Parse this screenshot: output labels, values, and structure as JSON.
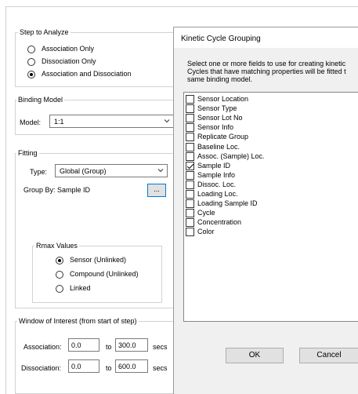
{
  "step": {
    "title": "Step to Analyze",
    "options": [
      "Association Only",
      "Dissociation Only",
      "Association and Dissociation"
    ],
    "selected": 2
  },
  "binding": {
    "title": "Binding Model",
    "model_label": "Model:",
    "model_value": "1:1"
  },
  "fitting": {
    "title": "Fitting",
    "type_label": "Type:",
    "type_value": "Global (Group)",
    "group_by": "Group By:  Sample ID",
    "browse_label": "...",
    "rmax": {
      "title": "Rmax Values",
      "options": [
        "Sensor (Unlinked)",
        "Compound (Unlinked)",
        "Linked"
      ],
      "selected": 0
    }
  },
  "window": {
    "title": "Window of Interest (from start of step)",
    "association_label": "Association:",
    "association_from": "0.0",
    "association_to": "300.0",
    "dissociation_label": "Dissociation:",
    "dissociation_from": "0.0",
    "dissociation_to": "600.0",
    "to_label": "to",
    "unit": "secs"
  },
  "dialog": {
    "title": "Kinetic Cycle Grouping",
    "instructions": "Select one or more fields to use for creating kinetic\nCycles that have matching properties will be fitted t\nsame binding model.",
    "fields": [
      {
        "label": "Sensor Location",
        "checked": false
      },
      {
        "label": "Sensor Type",
        "checked": false
      },
      {
        "label": "Sensor Lot No",
        "checked": false
      },
      {
        "label": "Sensor Info",
        "checked": false
      },
      {
        "label": "Replicate Group",
        "checked": false
      },
      {
        "label": "Baseline Loc.",
        "checked": false
      },
      {
        "label": "Assoc. (Sample) Loc.",
        "checked": false
      },
      {
        "label": "Sample ID",
        "checked": true
      },
      {
        "label": "Sample Info",
        "checked": false
      },
      {
        "label": "Dissoc. Loc.",
        "checked": false
      },
      {
        "label": "Loading Loc.",
        "checked": false
      },
      {
        "label": "Loading Sample ID",
        "checked": false
      },
      {
        "label": "Cycle",
        "checked": false
      },
      {
        "label": "Concentration",
        "checked": false
      },
      {
        "label": "Color",
        "checked": false
      }
    ],
    "ok_label": "OK",
    "cancel_label": "Cancel"
  }
}
